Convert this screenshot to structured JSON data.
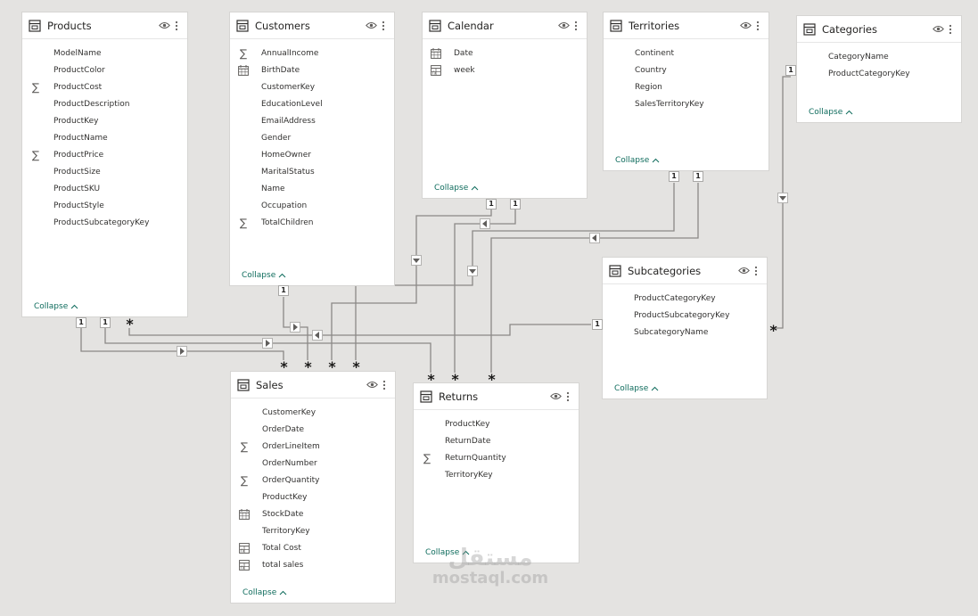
{
  "tables": [
    {
      "key": "products",
      "title": "Products",
      "collapse": "Collapse",
      "fields": [
        {
          "label": "ModelName",
          "icon": ""
        },
        {
          "label": "ProductColor",
          "icon": ""
        },
        {
          "label": "ProductCost",
          "icon": "sigma"
        },
        {
          "label": "ProductDescription",
          "icon": ""
        },
        {
          "label": "ProductKey",
          "icon": ""
        },
        {
          "label": "ProductName",
          "icon": ""
        },
        {
          "label": "ProductPrice",
          "icon": "sigma"
        },
        {
          "label": "ProductSize",
          "icon": ""
        },
        {
          "label": "ProductSKU",
          "icon": ""
        },
        {
          "label": "ProductStyle",
          "icon": ""
        },
        {
          "label": "ProductSubcategoryKey",
          "icon": ""
        }
      ]
    },
    {
      "key": "customers",
      "title": "Customers",
      "collapse": "Collapse",
      "fields": [
        {
          "label": "AnnualIncome",
          "icon": "sigma"
        },
        {
          "label": "BirthDate",
          "icon": "calendar"
        },
        {
          "label": "CustomerKey",
          "icon": ""
        },
        {
          "label": "EducationLevel",
          "icon": ""
        },
        {
          "label": "EmailAddress",
          "icon": ""
        },
        {
          "label": "Gender",
          "icon": ""
        },
        {
          "label": "HomeOwner",
          "icon": ""
        },
        {
          "label": "MaritalStatus",
          "icon": ""
        },
        {
          "label": "Name",
          "icon": ""
        },
        {
          "label": "Occupation",
          "icon": ""
        },
        {
          "label": "TotalChildren",
          "icon": "sigma"
        }
      ]
    },
    {
      "key": "calendar",
      "title": "Calendar",
      "collapse": "Collapse",
      "fields": [
        {
          "label": "Date",
          "icon": "calendar"
        },
        {
          "label": "week",
          "icon": "calc"
        }
      ]
    },
    {
      "key": "territories",
      "title": "Territories",
      "collapse": "Collapse",
      "fields": [
        {
          "label": "Continent",
          "icon": ""
        },
        {
          "label": "Country",
          "icon": ""
        },
        {
          "label": "Region",
          "icon": ""
        },
        {
          "label": "SalesTerritoryKey",
          "icon": ""
        }
      ]
    },
    {
      "key": "categories",
      "title": "Categories",
      "collapse": "Collapse",
      "fields": [
        {
          "label": "CategoryName",
          "icon": ""
        },
        {
          "label": "ProductCategoryKey",
          "icon": ""
        }
      ]
    },
    {
      "key": "subcategories",
      "title": "Subcategories",
      "collapse": "Collapse",
      "fields": [
        {
          "label": "ProductCategoryKey",
          "icon": ""
        },
        {
          "label": "ProductSubcategoryKey",
          "icon": ""
        },
        {
          "label": "SubcategoryName",
          "icon": ""
        }
      ]
    },
    {
      "key": "sales",
      "title": "Sales",
      "collapse": "Collapse",
      "fields": [
        {
          "label": "CustomerKey",
          "icon": ""
        },
        {
          "label": "OrderDate",
          "icon": ""
        },
        {
          "label": "OrderLineItem",
          "icon": "sigma"
        },
        {
          "label": "OrderNumber",
          "icon": ""
        },
        {
          "label": "OrderQuantity",
          "icon": "sigma"
        },
        {
          "label": "ProductKey",
          "icon": ""
        },
        {
          "label": "StockDate",
          "icon": "calendar"
        },
        {
          "label": "TerritoryKey",
          "icon": ""
        },
        {
          "label": "Total Cost",
          "icon": "calc"
        },
        {
          "label": "total sales",
          "icon": "calc"
        }
      ]
    },
    {
      "key": "returns",
      "title": "Returns",
      "collapse": "Collapse",
      "fields": [
        {
          "label": "ProductKey",
          "icon": ""
        },
        {
          "label": "ReturnDate",
          "icon": ""
        },
        {
          "label": "ReturnQuantity",
          "icon": "sigma"
        },
        {
          "label": "TerritoryKey",
          "icon": ""
        }
      ]
    }
  ],
  "relationships": [
    {
      "from": "Customers",
      "to": "Sales",
      "from_card": "1",
      "to_card": "*"
    },
    {
      "from": "Calendar",
      "to": "Sales",
      "from_card": "1",
      "to_card": "*"
    },
    {
      "from": "Calendar",
      "to": "Returns",
      "from_card": "1",
      "to_card": "*"
    },
    {
      "from": "Territories",
      "to": "Sales",
      "from_card": "1",
      "to_card": "*"
    },
    {
      "from": "Territories",
      "to": "Returns",
      "from_card": "1",
      "to_card": "*"
    },
    {
      "from": "Products",
      "to": "Sales",
      "from_card": "1",
      "to_card": "*"
    },
    {
      "from": "Products",
      "to": "Returns",
      "from_card": "1",
      "to_card": "*"
    },
    {
      "from": "Subcategories",
      "to": "Products",
      "from_card": "1",
      "to_card": "*"
    },
    {
      "from": "Categories",
      "to": "Subcategories",
      "from_card": "1",
      "to_card": "*"
    }
  ],
  "cardinality_labels": {
    "one": "1",
    "many": "*"
  },
  "watermark": {
    "arabic": "مستقل",
    "latin": "mostaql.com"
  },
  "colors": {
    "canvas": "#e4e3e1",
    "card": "#ffffff",
    "connector": "#8a8886",
    "collapse_link": "#0f6c5d"
  }
}
